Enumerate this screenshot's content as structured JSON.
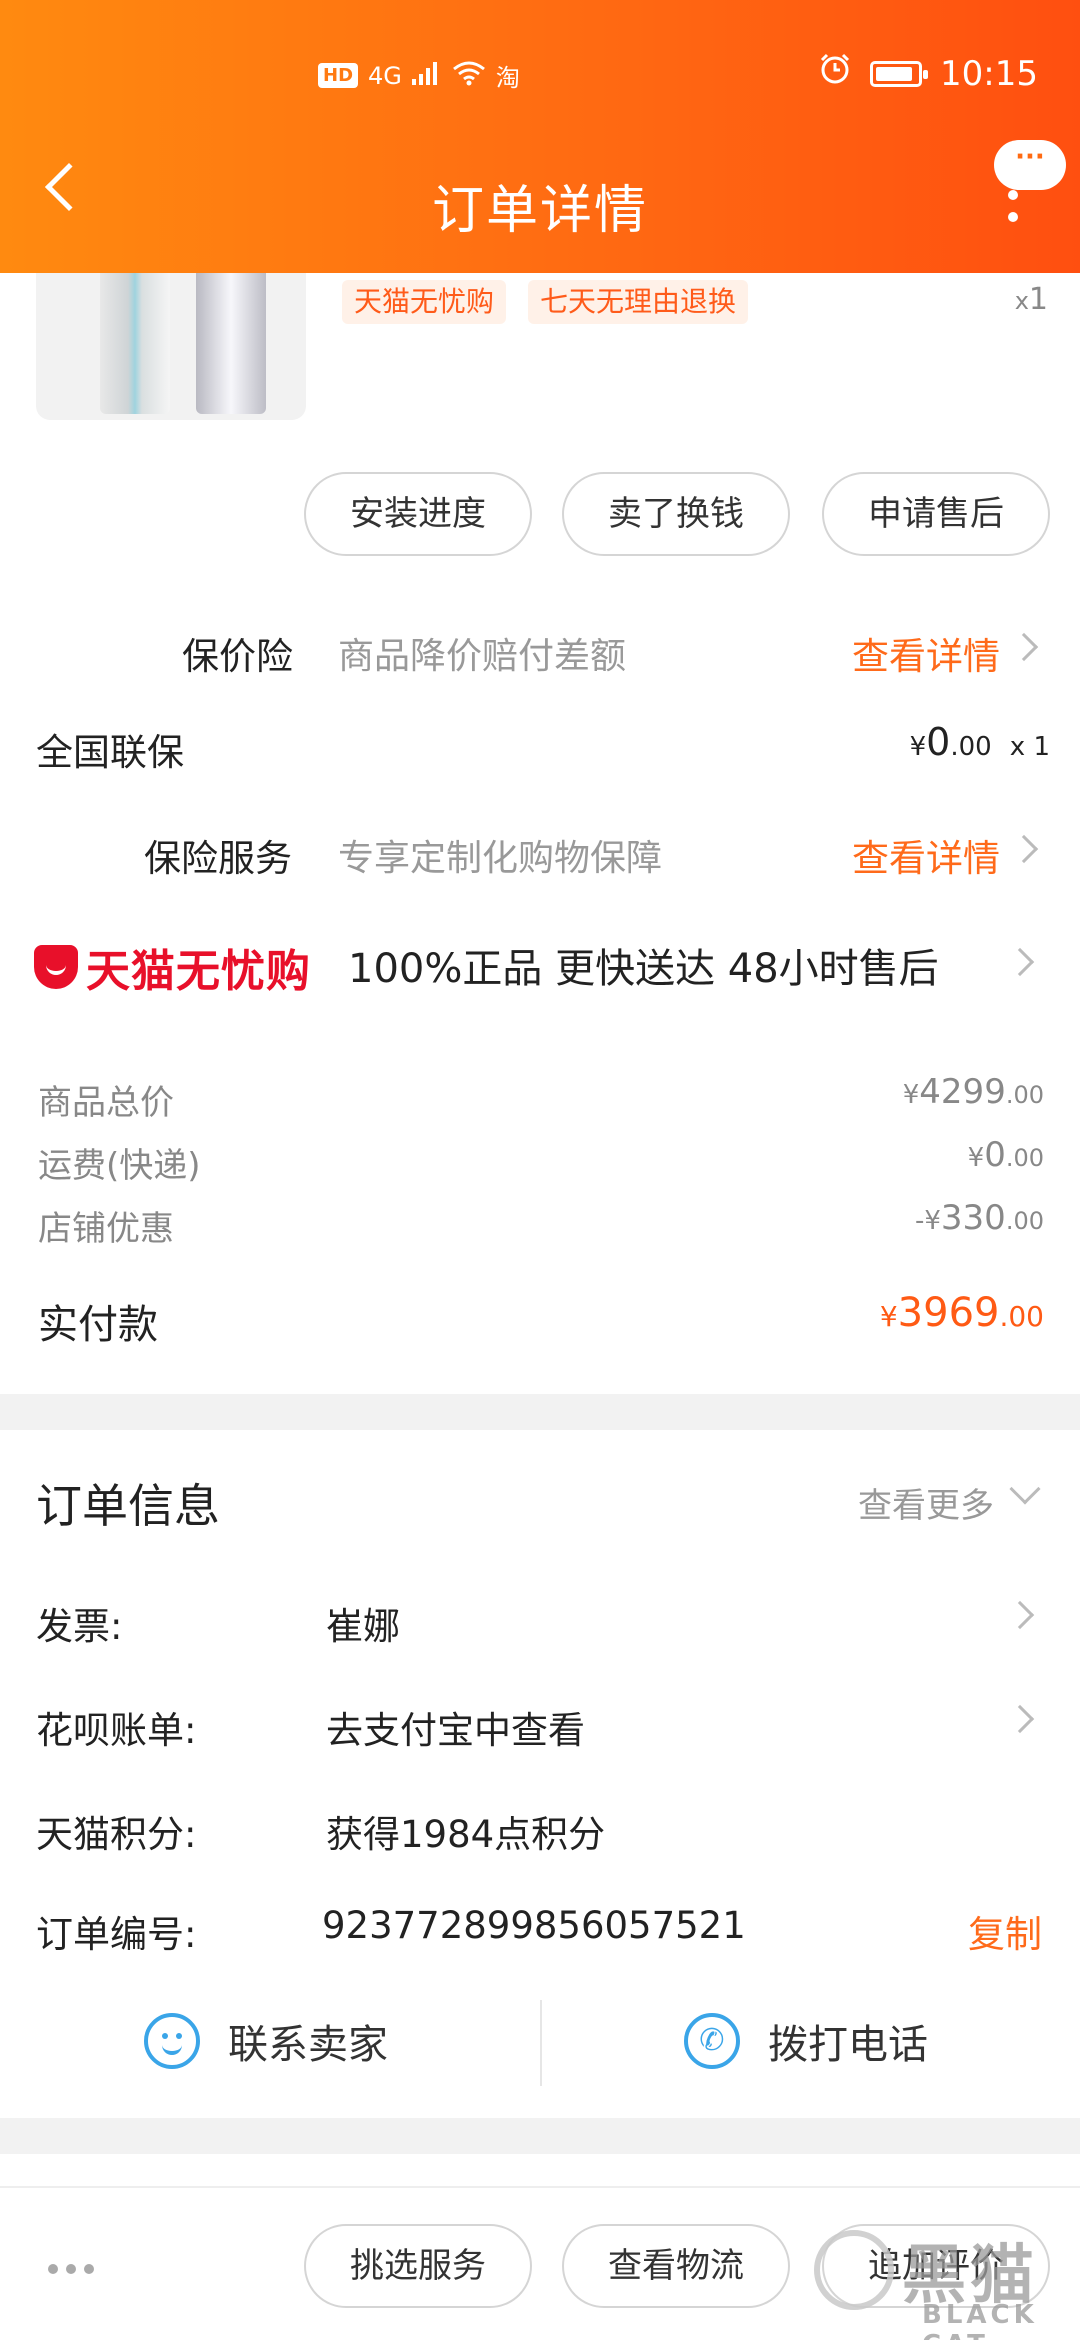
{
  "status_bar": {
    "net_hd": "HD",
    "net_4g": "4G",
    "app_badge": "淘",
    "time": "10:15"
  },
  "header": {
    "title": "订单详情",
    "more_label": "···"
  },
  "product": {
    "tags": [
      "天猫无忧购",
      "七天无理由退换"
    ],
    "qty_x": "x",
    "qty": "1"
  },
  "actions": [
    "安装进度",
    "卖了换钱",
    "申请售后"
  ],
  "price_protect": {
    "label": "保价险",
    "desc": "商品降价赔付差额",
    "link": "查看详情"
  },
  "warranty": {
    "label": "全国联保",
    "symbol": "¥",
    "int": "0",
    "dec": ".00",
    "qty": "x 1"
  },
  "insurance": {
    "label": "保险服务",
    "desc": "专享定制化购物保障",
    "link": "查看详情"
  },
  "tmall_worry_free": {
    "brand": "天猫无忧购",
    "promise": "100%正品  更快送达  48小时售后"
  },
  "prices": [
    {
      "label": "商品总价",
      "prefix": "¥",
      "int": "4299",
      "dec": ".00"
    },
    {
      "label": "运费(快递)",
      "prefix": "¥",
      "int": "0",
      "dec": ".00"
    },
    {
      "label": "店铺优惠",
      "prefix": "-¥",
      "int": "330",
      "dec": ".00"
    }
  ],
  "paid": {
    "label": "实付款",
    "symbol": "¥",
    "int": "3969",
    "dec": ".00"
  },
  "order_info": {
    "title": "订单信息",
    "see_more": "查看更多",
    "rows": [
      {
        "key": "发票:",
        "value": "崔娜"
      },
      {
        "key": "花呗账单:",
        "value": "去支付宝中查看"
      },
      {
        "key": "天猫积分:",
        "value": "获得1984点积分"
      },
      {
        "key": "订单编号:",
        "value": "923772899856057521"
      }
    ],
    "copy": "复制"
  },
  "contact": {
    "seller": "联系卖家",
    "phone": "拨打电话"
  },
  "bottom_actions": [
    "挑选服务",
    "查看物流",
    "追加评价"
  ],
  "watermark": {
    "cn": "黑猫",
    "en": "BLACK CAT"
  }
}
